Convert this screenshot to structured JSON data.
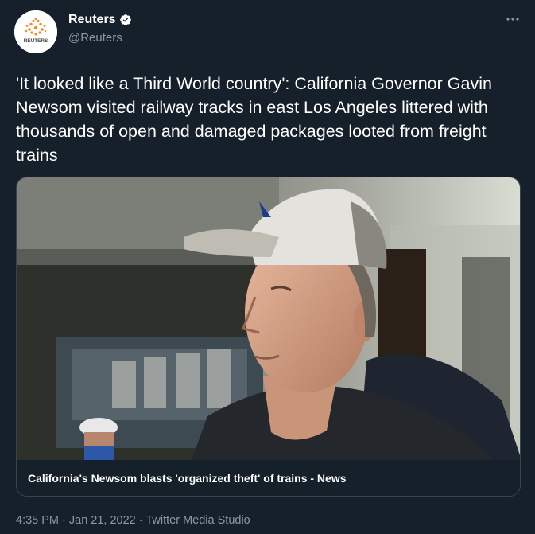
{
  "author": {
    "display_name": "Reuters",
    "handle": "@Reuters",
    "avatar_text": "REUTERS",
    "verified_icon": "verified-badge-icon"
  },
  "more_icon": "more-options-icon",
  "tweet": {
    "text": "'It looked like a Third World country': California Governor Gavin Newsom visited railway tracks in east Los Angeles littered with thousands of open and damaged packages looted from freight trains"
  },
  "card": {
    "title": "California's Newsom blasts 'organized theft' of trains - News",
    "media_icon": "video-thumbnail"
  },
  "meta": {
    "time": "4:35 PM",
    "separator": " · ",
    "date": "Jan 21, 2022",
    "source": "Twitter Media Studio"
  },
  "colors": {
    "background": "#15202b",
    "text": "#ffffff",
    "secondary": "#8b98a5",
    "verified": "#ffffff",
    "reuters_orange": "#f28c1e"
  }
}
